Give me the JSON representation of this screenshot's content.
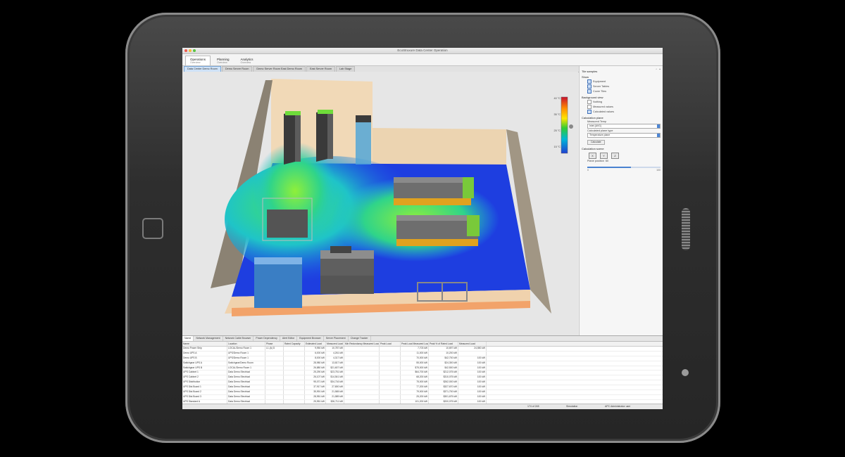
{
  "window": {
    "title": "EcoStruxure Data Center Operation"
  },
  "main_tabs": [
    {
      "label": "Operations",
      "sub": "Overview",
      "active": true
    },
    {
      "label": "Planning",
      "sub": "Overview",
      "active": false
    },
    {
      "label": "Analytics",
      "sub": "Overview",
      "active": false
    }
  ],
  "doc_tabs": [
    {
      "label": "Data Center Demo Room",
      "active": true
    },
    {
      "label": "Demo Server Room",
      "active": false
    },
    {
      "label": "Demo Server Room East Demo Room",
      "active": false
    },
    {
      "label": "East Server Room",
      "active": false
    },
    {
      "label": "Lab Stage",
      "active": false
    }
  ],
  "legend": {
    "labels": [
      "40 °C",
      "35 °C",
      "25 °C",
      "15 °C"
    ],
    "colors": [
      "#c8102e",
      "#ff8c00",
      "#ffe600",
      "#33cc33",
      "#00b7d8",
      "#1f3fd1"
    ]
  },
  "right_panel": {
    "sections": [
      {
        "title": "Tile samples",
        "items": []
      },
      {
        "title": "Show",
        "items": [
          {
            "label": "Equipment",
            "checked": true
          },
          {
            "label": "Server Tables",
            "checked": true
          },
          {
            "label": "Cover Tiles",
            "checked": true
          }
        ]
      },
      {
        "title": "Background view",
        "items": [
          {
            "label": "Nothing",
            "checked": false
          },
          {
            "label": "Measured values",
            "checked": false
          },
          {
            "label": "Calculated values",
            "checked": true
          }
        ]
      },
      {
        "title": "Calculation plane",
        "items": []
      }
    ],
    "measured_label": "Measured Temp",
    "measured_value": "Inlet (AVG)",
    "calc_label": "Calculated plane type",
    "calc_value": "Temperature plane",
    "apply_button": "Calculate",
    "section_plane": "Calculation scene",
    "plane_icons": [
      "X",
      "Y",
      "Z"
    ],
    "plane_position_label": "Plane position",
    "plane_position_value": "60",
    "slider_min": "0",
    "slider_max": "100",
    "slider_value": 0.6
  },
  "bottom_tabs": [
    "Name",
    "Network Management",
    "Network Cable Browser",
    "Power Dependency",
    "Alert Editor",
    "Equipment Browser",
    "Server Placement",
    "Change Tracker"
  ],
  "grid": {
    "columns": [
      "Name",
      "Location",
      "Phase",
      "Rated Capacity",
      "Estimated Load",
      "Measured Load",
      "Min Redundancy Measured Load",
      "Peak Load",
      "Peak Load Measured Load",
      "Peak % of Rated Load",
      "Measured Load"
    ],
    "rows": [
      [
        "Demo Power Strip",
        "LOCAL/Demo Room 1",
        "L1 (A) D",
        "",
        "9,950 kW",
        "10,787 kW",
        "",
        "",
        "7,703 kW",
        "10,697 kW",
        "24,550 kW"
      ],
      [
        "Demo UPS A",
        "UPS/Demo Room 1",
        "",
        "",
        "6,000 kW",
        "4,261 kW",
        "",
        "",
        "11,000 kW",
        "10,200 kW",
        ""
      ],
      [
        "Demo UPS B",
        "UPS/Demo Room 1",
        "",
        "",
        "8,000 kW",
        "4,317 kW",
        "",
        "",
        "70,000 kW",
        "$42,700 kW",
        "100 kW"
      ],
      [
        "Switchgear UPS A",
        "Switchgear/Demo Room",
        "",
        "",
        "28,980 kW",
        "13,817 kW",
        "",
        "",
        "55,000 kW",
        "$24,300 kW",
        "100 kW"
      ],
      [
        "Switchgear UPS B",
        "LOCAL/Demo Room 1",
        "",
        "",
        "26,880 kW",
        "$21,607 kW",
        "",
        "",
        "$75,000 kW",
        "$42,500 kW",
        "100 kW"
      ],
      [
        "UPS Cabinet 1",
        "Data Demo Electrical",
        "",
        "",
        "25,290 kW",
        "$23,751 kW",
        "",
        "",
        "$64,700 kW",
        "$212,075 kW",
        "100 kW"
      ],
      [
        "UPS Cabinet 2",
        "Data Demo Electrical",
        "",
        "",
        "26,107 kW",
        "$14,541 kW",
        "",
        "",
        "68,200 kW",
        "$310,075 kW",
        "100 kW"
      ],
      [
        "UPS Distribution",
        "Data Demo Electrical",
        "",
        "",
        "95,071 kW",
        "$34,716 kW",
        "",
        "",
        "75,000 kW",
        "$262,000 kW",
        "100 kW"
      ],
      [
        "UPS Dist Board 1",
        "Data Demo Electrical",
        "",
        "",
        "37,917 kW",
        "27,800 kW",
        "",
        "",
        "77,200 kW",
        "$327,670 kW",
        "100 kW"
      ],
      [
        "UPS Dist Board 2",
        "Data Demo Electrical",
        "",
        "",
        "35,991 kW",
        "21,565 kW",
        "",
        "",
        "79,000 kW",
        "$371,700 kW",
        "100 kW"
      ],
      [
        "UPS Dist Board 3",
        "Data Demo Electrical",
        "",
        "",
        "28,951 kW",
        "21,589 kW",
        "",
        "",
        "25,200 kW",
        "$301,675 kW",
        "100 kW"
      ],
      [
        "UPS Standard A",
        "Data Demo Electrical",
        "",
        "",
        "25,951 kW",
        "$26,711 kW",
        "",
        "",
        "101,200 kW",
        "$200,075 kW",
        "100 kW"
      ],
      [
        "UPS Standard B",
        "Data Demo Electrical",
        "",
        "",
        "28,992 kW",
        "$22,870 kW",
        "",
        "",
        "101,000 kW",
        "$200,075 kW",
        "100 kW"
      ]
    ]
  },
  "status": {
    "left": "",
    "counter": "174 of 245",
    "mode": "Simulation",
    "user": "APC Administrator user"
  },
  "colors": {
    "accent": "#4a82d0",
    "floor": "#1e3ee0",
    "wall": "#efd7b5"
  }
}
